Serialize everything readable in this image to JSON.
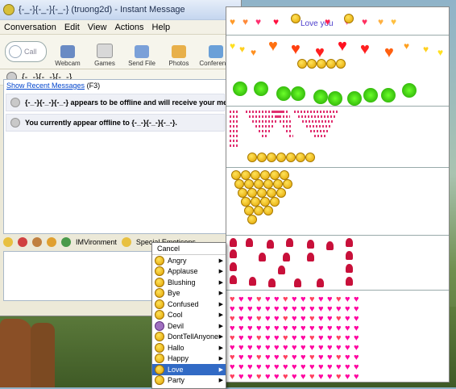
{
  "window": {
    "title": "{-_-}{-_-}{-_-} (truong2d) - Instant Message"
  },
  "menubar": {
    "items": [
      "Conversation",
      "Edit",
      "View",
      "Actions",
      "Help"
    ]
  },
  "toolbar": {
    "call_label": "Call",
    "tools": [
      {
        "label": "Webcam",
        "color": "#6a8bc4"
      },
      {
        "label": "Games",
        "color": "#d8d8d8"
      },
      {
        "label": "Send File",
        "color": "#7aa0d8"
      },
      {
        "label": "Photos",
        "color": "#e8b04a"
      },
      {
        "label": "Conference",
        "color": "#6aa0d8"
      }
    ]
  },
  "contact": {
    "name": "{-_-}{-_-}{-_-}"
  },
  "conversation": {
    "recent_link": "Show Recent Messages",
    "recent_key": "(F3)",
    "msg1_name": "{-_-}{-_-}{-_-}",
    "msg1_text": "appears to be offline and will receive your messag",
    "msg2_text": "You currently appear offline to {-_-}{-_-}{-_-}."
  },
  "format_bar": {
    "imvironment": "IMVironment",
    "special": "Special Emoticons"
  },
  "emoticon_pane": {
    "love_text": "Love you"
  },
  "context_menu": {
    "items": [
      {
        "label": "Cancel",
        "submenu": false,
        "selected": false
      },
      {
        "label": "Angry",
        "submenu": true,
        "selected": false
      },
      {
        "label": "Applause",
        "submenu": true,
        "selected": false
      },
      {
        "label": "Blushing",
        "submenu": true,
        "selected": false
      },
      {
        "label": "Bye",
        "submenu": true,
        "selected": false
      },
      {
        "label": "Confused",
        "submenu": true,
        "selected": false
      },
      {
        "label": "Cool",
        "submenu": true,
        "selected": false
      },
      {
        "label": "Devil",
        "submenu": true,
        "selected": false
      },
      {
        "label": "DontTellAnyone",
        "submenu": true,
        "selected": false
      },
      {
        "label": "Hallo",
        "submenu": true,
        "selected": false
      },
      {
        "label": "Happy",
        "submenu": true,
        "selected": false
      },
      {
        "label": "Love",
        "submenu": true,
        "selected": true
      },
      {
        "label": "Party",
        "submenu": true,
        "selected": false
      }
    ]
  },
  "colors": {
    "accent": "#316ac5",
    "link": "#0044cc",
    "love_text": "#4b3dcc"
  }
}
